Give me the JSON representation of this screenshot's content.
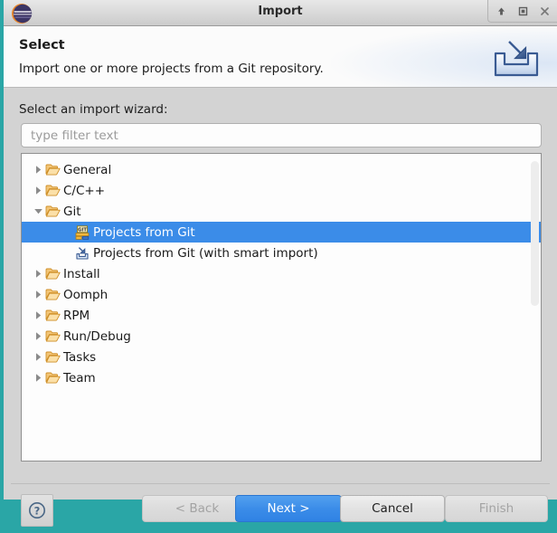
{
  "window": {
    "title": "Import",
    "controls": [
      {
        "name": "shade-button",
        "icon": "up-arrow-icon"
      },
      {
        "name": "maximize-button",
        "icon": "square-icon"
      },
      {
        "name": "close-button",
        "icon": "close-x-icon"
      }
    ],
    "logo_icon": "eclipse-logo-icon"
  },
  "header": {
    "title": "Select",
    "description": "Import one or more projects from a Git repository.",
    "banner_icon": "import-arrow-tray-icon"
  },
  "form": {
    "wizard_label": "Select an import wizard:",
    "filter": {
      "value": "",
      "placeholder": "type filter text"
    }
  },
  "tree": {
    "items": [
      {
        "label": "General",
        "level": 0,
        "icon": "folder-icon",
        "twisty": "collapsed",
        "selected": false
      },
      {
        "label": "C/C++",
        "level": 0,
        "icon": "folder-icon",
        "twisty": "collapsed",
        "selected": false
      },
      {
        "label": "Git",
        "level": 0,
        "icon": "folder-icon",
        "twisty": "expanded",
        "selected": false
      },
      {
        "label": "Projects from Git",
        "level": 1,
        "icon": "git-badge-icon",
        "twisty": "none",
        "selected": true
      },
      {
        "label": "Projects from Git (with smart import)",
        "level": 1,
        "icon": "smart-import-icon",
        "twisty": "none",
        "selected": false
      },
      {
        "label": "Install",
        "level": 0,
        "icon": "folder-icon",
        "twisty": "collapsed",
        "selected": false
      },
      {
        "label": "Oomph",
        "level": 0,
        "icon": "folder-icon",
        "twisty": "collapsed",
        "selected": false
      },
      {
        "label": "RPM",
        "level": 0,
        "icon": "folder-icon",
        "twisty": "collapsed",
        "selected": false
      },
      {
        "label": "Run/Debug",
        "level": 0,
        "icon": "folder-icon",
        "twisty": "collapsed",
        "selected": false
      },
      {
        "label": "Tasks",
        "level": 0,
        "icon": "folder-icon",
        "twisty": "collapsed",
        "selected": false
      },
      {
        "label": "Team",
        "level": 0,
        "icon": "folder-icon",
        "twisty": "collapsed",
        "selected": false
      }
    ]
  },
  "buttons": {
    "help": {
      "label": "?",
      "icon": "help-question-icon"
    },
    "back": {
      "label": "< Back",
      "enabled": false
    },
    "next": {
      "label": "Next >",
      "enabled": true,
      "primary": true
    },
    "cancel": {
      "label": "Cancel",
      "enabled": true
    },
    "finish": {
      "label": "Finish",
      "enabled": false
    }
  },
  "colors": {
    "selection_blue": "#3b8ce8",
    "dialog_gray": "#d3d3d3",
    "folder_orange": "#e8a33d",
    "desktop_teal": "#2aa6a6"
  }
}
